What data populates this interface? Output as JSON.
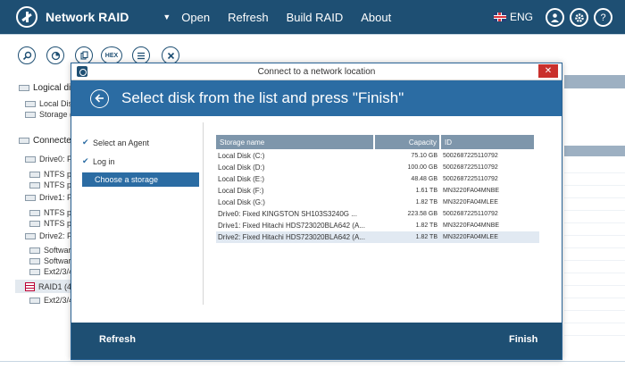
{
  "app": {
    "title": "Network RAID",
    "menu": [
      "Open",
      "Refresh",
      "Build RAID",
      "About"
    ],
    "language": "ENG"
  },
  "toolbar": {
    "hex_label": "HEX"
  },
  "tree": {
    "group1": "Logical di",
    "group1_items": [
      "Local Disk",
      "Storage ("
    ],
    "group2": "Connecte",
    "drives": [
      {
        "label": "Drive0: Fi",
        "items": [
          "NTFS pa",
          "NTFS pa"
        ]
      },
      {
        "label": "Drive1: Fi",
        "items": [
          "NTFS pa",
          "NTFS pa"
        ]
      },
      {
        "label": "Drive2: Fi",
        "items": [
          "Software",
          "Software",
          "Ext2/3/4"
        ]
      }
    ],
    "raid": {
      "label": "RAID1 (4",
      "items": [
        "Ext2/3/4"
      ]
    }
  },
  "dialog": {
    "window_title": "Connect to a network location",
    "close_glyph": "✕",
    "heading": "Select disk from the list and press \"Finish\"",
    "steps": [
      {
        "label": "Select an Agent",
        "done": true
      },
      {
        "label": "Log in",
        "done": true
      },
      {
        "label": "Choose a storage",
        "done": false
      }
    ],
    "columns": [
      "Storage name",
      "Capacity",
      "ID"
    ],
    "rows": [
      {
        "name": "Local Disk (C:)",
        "capacity": "75.10 GB",
        "id": "5002687225110792"
      },
      {
        "name": "Local Disk (D:)",
        "capacity": "100.00 GB",
        "id": "5002687225110792"
      },
      {
        "name": "Local Disk (E:)",
        "capacity": "48.48 GB",
        "id": "5002687225110792"
      },
      {
        "name": "Local Disk (F:)",
        "capacity": "1.61 TB",
        "id": "MN3220FA04MNBE"
      },
      {
        "name": "Local Disk (G:)",
        "capacity": "1.82 TB",
        "id": "MN3220FA04MLEE"
      },
      {
        "name": "Drive0: Fixed KINGSTON SH103S3240G      ...",
        "capacity": "223.58 GB",
        "id": "5002687225110792"
      },
      {
        "name": "Drive1: Fixed Hitachi HDS723020BLA642 (A...",
        "capacity": "1.82 TB",
        "id": "MN3220FA04MNBE"
      },
      {
        "name": "Drive2: Fixed Hitachi HDS723020BLA642 (A...",
        "capacity": "1.82 TB",
        "id": "MN3220FA04MLEE"
      }
    ],
    "selected_row": 7,
    "footer": {
      "refresh": "Refresh",
      "finish": "Finish"
    }
  },
  "colors": {
    "appbar": "#1e4f73",
    "dialog_header": "#2b6ca3",
    "close_button": "#c9302c"
  }
}
